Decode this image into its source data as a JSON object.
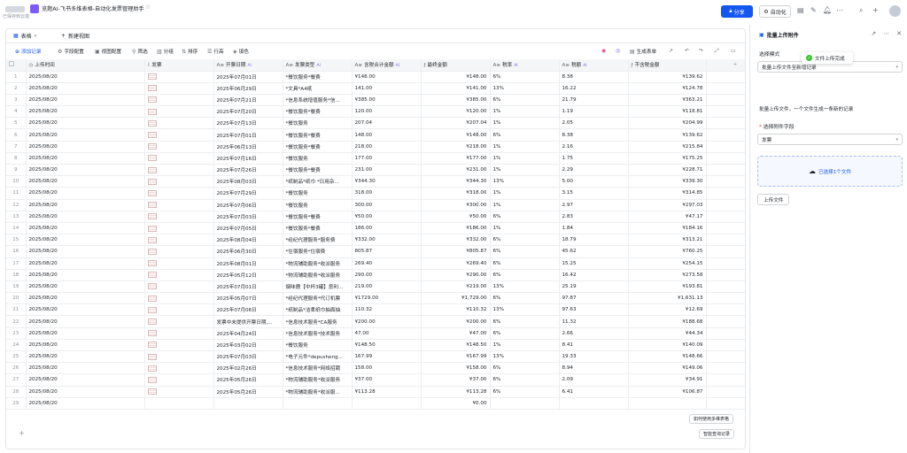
{
  "topbar": {
    "title": "览题AI-飞书多维表格-自动化发票管理助手",
    "saved_text": "已保存到云端",
    "share_label": "分享",
    "automation_label": "自动化"
  },
  "tabs": {
    "active": "表格",
    "new_view": "新建视图"
  },
  "toolbar": {
    "add_record": "添加记录",
    "field_config": "字段配置",
    "view_config": "视图配置",
    "filter": "筛选",
    "group": "分组",
    "sort": "排序",
    "row_height": "行高",
    "fill_color": "填色",
    "generate_form": "生成表单"
  },
  "columns": [
    "上传时间",
    "发票",
    "开票日期",
    "发票类型",
    "含税合计金额",
    "最终金额",
    "税率",
    "税额",
    "不含税金额"
  ],
  "rows": [
    [
      "1",
      "2025/08/20",
      "2025年07月01日",
      "*餐饮服务*餐费",
      "¥148.00",
      "¥148.00",
      "6%",
      "8.38",
      "¥139.62"
    ],
    [
      "2",
      "2025/08/20",
      "2025年06月29日",
      "*文具*A4纸",
      "141.00",
      "¥141.00",
      "13%",
      "16.22",
      "¥124.78"
    ],
    [
      "3",
      "2025/08/20",
      "2025年07月21日",
      "*信息系统增值服务*信...",
      "¥385.00",
      "¥385.00",
      "6%",
      "21.79",
      "¥363.21"
    ],
    [
      "4",
      "2025/08/20",
      "2025年07月20日",
      "*餐饮服务*餐费",
      "120.00",
      "¥120.00",
      "1%",
      "1.19",
      "¥118.81"
    ],
    [
      "5",
      "2025/08/20",
      "2025年07月13日",
      "*餐饮服务",
      "207.04",
      "¥207.04",
      "1%",
      "2.05",
      "¥204.99"
    ],
    [
      "6",
      "2025/08/20",
      "2025年07月01日",
      "*餐饮服务*餐费",
      "148.00",
      "¥148.00",
      "6%",
      "8.38",
      "¥139.62"
    ],
    [
      "7",
      "2025/08/20",
      "2025年06月13日",
      "*餐饮服务*餐费",
      "218.00",
      "¥218.00",
      "1%",
      "2.16",
      "¥215.84"
    ],
    [
      "8",
      "2025/08/20",
      "2025年07月16日",
      "*餐饮服务",
      "177.00",
      "¥177.00",
      "1%",
      "1.75",
      "¥175.25"
    ],
    [
      "9",
      "2025/08/20",
      "2025年07月26日",
      "*餐饮服务*餐费",
      "231.00",
      "¥231.00",
      "1%",
      "2.29",
      "¥228.71"
    ],
    [
      "10",
      "2025/08/20",
      "2025年08月03日",
      "*纸制品*纸巾 *日用杂...",
      "¥344.30",
      "¥344.30",
      "13%",
      "5.00",
      "¥339.30"
    ],
    [
      "11",
      "2025/08/20",
      "2025年07月29日",
      "*餐饮服务",
      "318.00",
      "¥318.00",
      "1%",
      "3.15",
      "¥314.85"
    ],
    [
      "12",
      "2025/08/20",
      "2025年07月06日",
      "*餐饮服务",
      "300.00",
      "¥300.00",
      "1%",
      "2.97",
      "¥297.03"
    ],
    [
      "13",
      "2025/08/20",
      "2025年07月03日",
      "*餐饮服务*餐费",
      "¥50.00",
      "¥50.00",
      "6%",
      "2.83",
      "¥47.17"
    ],
    [
      "14",
      "2025/08/20",
      "2025年07月05日",
      "*餐饮服务*餐费",
      "186.00",
      "¥186.00",
      "1%",
      "1.84",
      "¥184.16"
    ],
    [
      "15",
      "2025/08/20",
      "2025年08月04日",
      "*经纪代理服务*服务费",
      "¥332.00",
      "¥332.00",
      "6%",
      "18.79",
      "¥313.21"
    ],
    [
      "16",
      "2025/08/20",
      "2025年06月30日",
      "*住宿服务*住宿费",
      "805.87",
      "¥805.87",
      "6%",
      "45.62",
      "¥760.25"
    ],
    [
      "17",
      "2025/08/20",
      "2025年08月01日",
      "*物流辅助服务*收派服务",
      "269.40",
      "¥269.40",
      "6%",
      "15.25",
      "¥254.15"
    ],
    [
      "18",
      "2025/08/20",
      "2025年05月12日",
      "*物流辅助服务*收派服务",
      "290.00",
      "¥290.00",
      "6%",
      "16.42",
      "¥273.58"
    ],
    [
      "19",
      "2025/08/20",
      "2025年07月01日",
      "烟味鹿【中杯3罐】意利...",
      "219.00",
      "¥219.00",
      "13%",
      "25.19",
      "¥193.81"
    ],
    [
      "20",
      "2025/08/20",
      "2025年05月07日",
      "*经纪代理服务*代订机票",
      "¥1729.00",
      "¥1,729.00",
      "6%",
      "97.87",
      "¥1,631.13"
    ],
    [
      "21",
      "2025/08/20",
      "2025年07月06日",
      "*纸制品*洁柔纸巾抽面抽",
      "110.32",
      "¥110.32",
      "13%",
      "97.63",
      "¥12.69"
    ],
    [
      "22",
      "2025/08/20",
      "发票中未提供开票日期,...",
      "*信息技术服务*CA服务",
      "¥200.00",
      "¥200.00",
      "6%",
      "11.32",
      "¥188.68"
    ],
    [
      "23",
      "2025/08/20",
      "2025年04月24日",
      "*信息技术服务*技术服务",
      "47.00",
      "¥47.00",
      "6%",
      "2.66",
      "¥44.34"
    ],
    [
      "24",
      "2025/08/20",
      "2025年03月02日",
      "*餐饮服务",
      "¥148.50",
      "¥148.50",
      "1%",
      "8.41",
      "¥140.09"
    ],
    [
      "25",
      "2025/08/20",
      "2025年07月03日",
      "*电子元件*depusheng...",
      "167.99",
      "¥167.99",
      "13%",
      "19.33",
      "¥148.66"
    ],
    [
      "26",
      "2025/08/20",
      "2025年02月26日",
      "*信息技术服务*网络招聘",
      "158.00",
      "¥158.00",
      "6%",
      "8.94",
      "¥149.06"
    ],
    [
      "27",
      "2025/08/20",
      "2025年05月26日",
      "*物流辅助服务*收派服务",
      "¥37.00",
      "¥37.00",
      "6%",
      "2.09",
      "¥34.91"
    ],
    [
      "28",
      "2025/08/20",
      "2025年05月26日",
      "*物流辅助服务*收派服...",
      "¥113.28",
      "¥113.28",
      "6%",
      "6.41",
      "¥106.87"
    ],
    [
      "29",
      "2025/08/20",
      "",
      "",
      "",
      "¥0.00",
      "",
      "",
      ""
    ]
  ],
  "footer": {
    "add_symbol": "+",
    "smart_query": "智能查询记录",
    "help": "如何使用多维表格"
  },
  "panel": {
    "title": "批量上传附件",
    "toast": "文件上传完成",
    "mode_label": "选择模式",
    "mode_value": "批量上传文件至新增记录",
    "description": "批量上传文件，一个文件生成一条新的记录",
    "field_label": "选择附件字段",
    "field_value": "发票",
    "selected_text": "已选择1个文件",
    "upload_button": "上传文件"
  }
}
